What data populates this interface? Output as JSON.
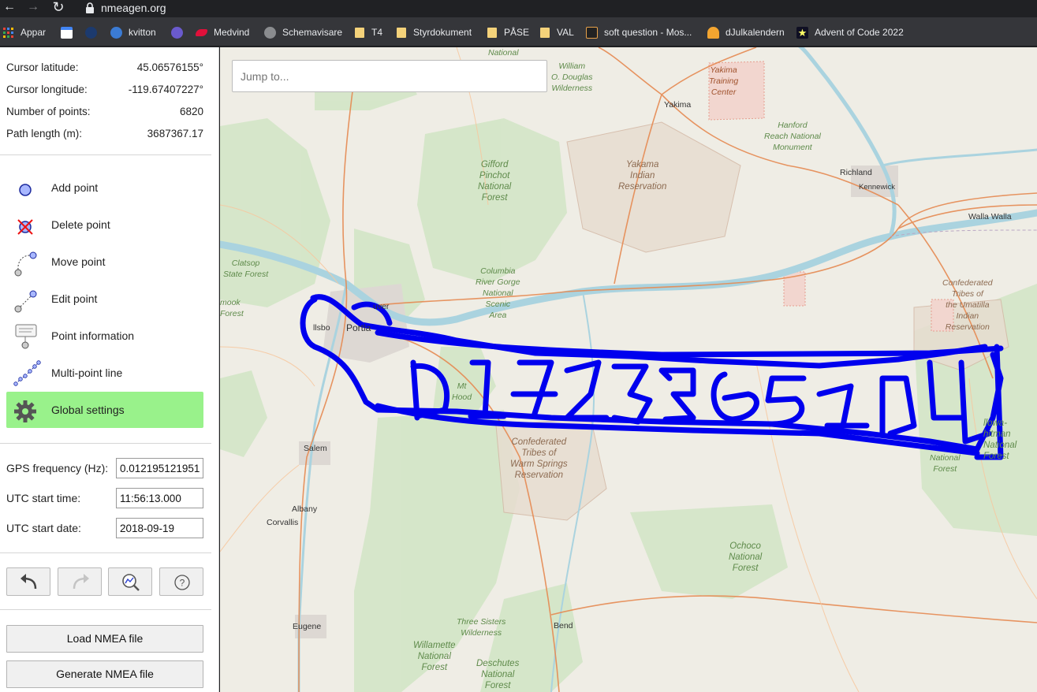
{
  "browser": {
    "url": "nmeagen.org",
    "nav_back": "←",
    "nav_forward": "→",
    "nav_reload": "↻",
    "bookmarks": [
      {
        "label": "Appar",
        "icon": "apps-grid-icon"
      },
      {
        "label": "",
        "icon": "calendar-icon"
      },
      {
        "label": "",
        "icon": "u-logo-icon"
      },
      {
        "label": "kvitton",
        "icon": "kvitton-icon"
      },
      {
        "label": "",
        "icon": "w-logo-icon"
      },
      {
        "label": "Medvind",
        "icon": "medvind-icon"
      },
      {
        "label": "Schemavisare",
        "icon": "globe-icon"
      },
      {
        "label": "T4",
        "icon": "folder-icon"
      },
      {
        "label": "Styrdokument",
        "icon": "folder-icon"
      },
      {
        "label": "PÅSE",
        "icon": "folder-icon"
      },
      {
        "label": "VAL",
        "icon": "folder-icon"
      },
      {
        "label": "soft question - Mos...",
        "icon": "mathoverflow-icon"
      },
      {
        "label": "dJulkalendern",
        "icon": "djulkalendern-icon"
      },
      {
        "label": "Advent of Code 2022",
        "icon": "star-icon"
      }
    ]
  },
  "info": {
    "lat_label": "Cursor latitude:",
    "lat_value": "45.06576155°",
    "lon_label": "Cursor longitude:",
    "lon_value": "-119.67407227°",
    "points_label": "Number of points:",
    "points_value": "6820",
    "path_label": "Path length (m):",
    "path_value": "3687367.17"
  },
  "tools": [
    {
      "label": "Add point",
      "icon": "add-point-icon"
    },
    {
      "label": "Delete point",
      "icon": "delete-point-icon"
    },
    {
      "label": "Move point",
      "icon": "move-point-icon"
    },
    {
      "label": "Edit point",
      "icon": "edit-point-icon"
    },
    {
      "label": "Point information",
      "icon": "point-info-icon"
    },
    {
      "label": "Multi-point line",
      "icon": "multi-point-line-icon"
    },
    {
      "label": "Global settings",
      "icon": "gear-icon",
      "active": true
    }
  ],
  "settings": {
    "gps_freq_label": "GPS frequency (Hz):",
    "gps_freq_value": "0.012195121951",
    "utc_time_label": "UTC start time:",
    "utc_time_value": "11:56:13.000",
    "utc_date_label": "UTC start date:",
    "utc_date_value": "2018-09-19"
  },
  "actions": {
    "undo_icon": "undo-icon",
    "redo_icon": "redo-icon",
    "zoom_fit_icon": "zoom-fit-icon",
    "help_icon": "help-icon",
    "load_label": "Load NMEA file",
    "generate_label": "Generate NMEA file"
  },
  "map": {
    "search_placeholder": "Jump to...",
    "track_color": "#0000ee",
    "labels": {
      "yakima_tc": "Yakima\nTraining\nCenter",
      "william": "William\nO. Douglas\nWilderness",
      "national": "National",
      "yakima": "Yakima",
      "hanford": "Hanford\nReach National\nMonument",
      "gifford": "Gifford\nPinchot\nNational\nForest",
      "yakama": "Yakama\nIndian\nReservation",
      "richland": "Richland",
      "kennewick": "Kennewick",
      "walla": "Walla Walla",
      "clatsop": "Clatsop\nState Forest",
      "columbia": "Columbia\nRiver Gorge\nNational\nScenic\nArea",
      "umatilla": "Confederated\nTribes of\nthe Umatilla\nIndian\nReservation",
      "tillamook": "mook\nForest",
      "portland": "Portla",
      "hillsboro": "llsbo",
      "vancouver": "uver",
      "mthood": "Mt\nHood",
      "warm_springs": "Confederated\nTribes of\nWarm Springs\nReservation",
      "wallowa": "llowa-\nhitman\nNational\nForest",
      "national_forest": "National\nForest",
      "salem": "Salem",
      "albany": "Albany",
      "corvallis": "Corvallis",
      "ochoco": "Ochoco\nNational\nForest",
      "eugene": "Eugene",
      "three_sisters": "Three Sisters\nWilderness",
      "bend": "Bend",
      "willamette": "Willamette\nNational\nForest",
      "deschutes": "Deschutes\nNational\nForest"
    }
  }
}
